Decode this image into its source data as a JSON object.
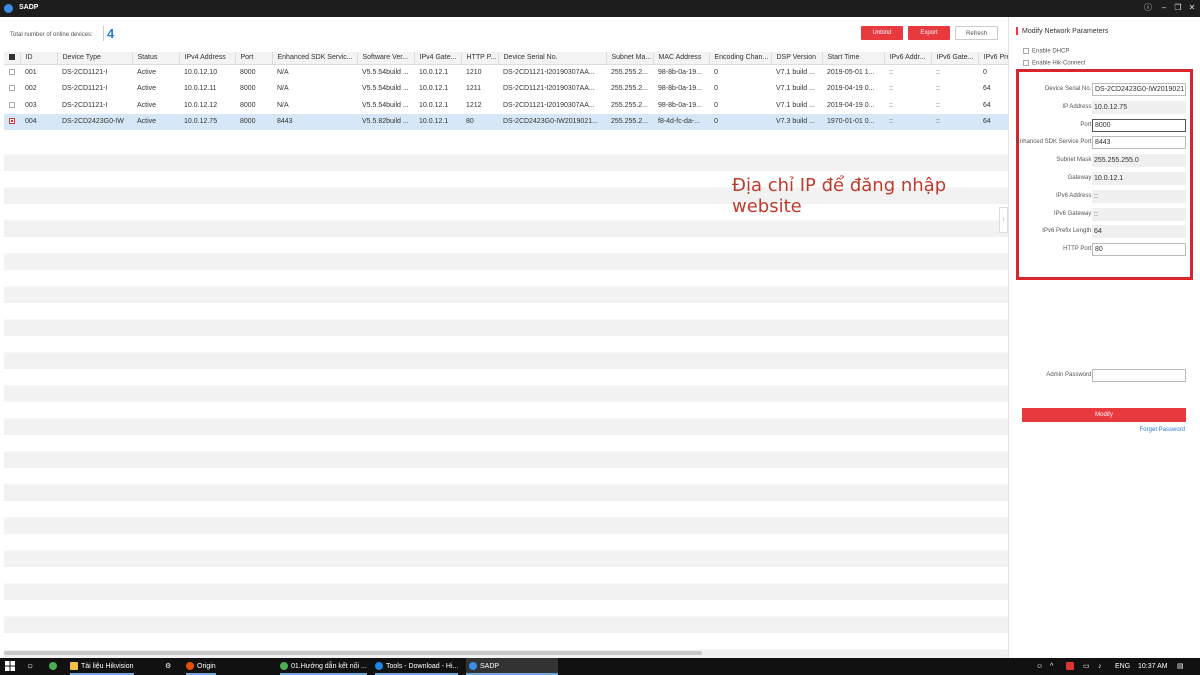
{
  "window": {
    "title": "SADP"
  },
  "toolbar": {
    "total_label": "Total number of online devices:",
    "total_count": "4",
    "unbind_label": "Unbind",
    "export_label": "Export",
    "refresh_label": "Refresh"
  },
  "table": {
    "columns": [
      "ID",
      "Device Type",
      "Status",
      "IPv4 Address",
      "Port",
      "Enhanced SDK Servic...",
      "Software Ver...",
      "IPv4 Gate...",
      "HTTP P...",
      "Device Serial No.",
      "Subnet Ma...",
      "MAC Address",
      "Encoding Chan...",
      "DSP Version",
      "Start Time",
      "IPv6 Addr...",
      "IPv6 Gate...",
      "IPv6 Prefix"
    ],
    "rows": [
      [
        "001",
        "DS-2CD1121-I",
        "Active",
        "10.0.12.10",
        "8000",
        "N/A",
        "V5.5.54build ...",
        "10.0.12.1",
        "1210",
        "DS-2CD1121-I20190307AA...",
        "255.255.2...",
        "98-8b-0a-19...",
        "0",
        "V7.1 build ...",
        "2019-05-01 1...",
        "::",
        "::",
        "0"
      ],
      [
        "002",
        "DS-2CD1121-I",
        "Active",
        "10.0.12.11",
        "8000",
        "N/A",
        "V5.5.54build ...",
        "10.0.12.1",
        "1211",
        "DS-2CD1121-I20190307AA...",
        "255.255.2...",
        "98-8b-0a-19...",
        "0",
        "V7.1 build ...",
        "2019-04-19 0...",
        "::",
        "::",
        "64"
      ],
      [
        "003",
        "DS-2CD1121-I",
        "Active",
        "10.0.12.12",
        "8000",
        "N/A",
        "V5.5.54build ...",
        "10.0.12.1",
        "1212",
        "DS-2CD1121-I20190307AA...",
        "255.255.2...",
        "98-8b-0a-19...",
        "0",
        "V7.1 build ...",
        "2019-04-19 0...",
        "::",
        "::",
        "64"
      ],
      [
        "004",
        "DS-2CD2423G0-IW",
        "Active",
        "10.0.12.75",
        "8000",
        "8443",
        "V5.5.82build ...",
        "10.0.12.1",
        "80",
        "DS-2CD2423G0-IW2019021...",
        "255.255.2...",
        "f8-4d-fc-da-...",
        "0",
        "V7.3 build ...",
        "1970-01-01 0...",
        "::",
        "::",
        "64"
      ]
    ],
    "selected_row": 3
  },
  "annotation": {
    "text": "Địa chỉ IP để đăng nhập website"
  },
  "panel": {
    "title": "Modify Network Parameters",
    "enable_dhcp": "Enable DHCP",
    "enable_hik": "Enable Hik-Connect",
    "fields": {
      "serial_label": "Device Serial No.:",
      "serial_value": "DS-2CD2423G0-IW2019021",
      "ip_label": "IP Address:",
      "ip_value": "10.0.12.75",
      "port_label": "Port:",
      "port_value": "8000",
      "sdk_label": "Enhanced SDK Service Port:",
      "sdk_value": "8443",
      "mask_label": "Subnet Mask:",
      "mask_value": "255.255.255.0",
      "gateway_label": "Gateway:",
      "gateway_value": "10.0.12.1",
      "ipv6_label": "IPv6 Address:",
      "ipv6_value": "::",
      "ipv6gw_label": "IPv6 Gateway:",
      "ipv6gw_value": "::",
      "prefix_label": "IPv6 Prefix Length:",
      "prefix_value": "64",
      "http_label": "HTTP Port:",
      "http_value": "80"
    },
    "admin_label": "Admin Password:",
    "modify_label": "Modify",
    "forget_label": "Forget Password"
  },
  "taskbar": {
    "items": [
      "Tài liệu Hikvision",
      "Origin",
      "01.Hướng dẫn kết nối ...",
      "Tools - Download - Hi...",
      "SADP"
    ],
    "lang": "ENG",
    "time": "10:37 AM",
    "colors": {
      "folder": "#f2c04a",
      "chrome": "#4caf50",
      "origin": "#e65100",
      "ie": "#1e88e5",
      "sadp": "#3a8ee6"
    }
  }
}
